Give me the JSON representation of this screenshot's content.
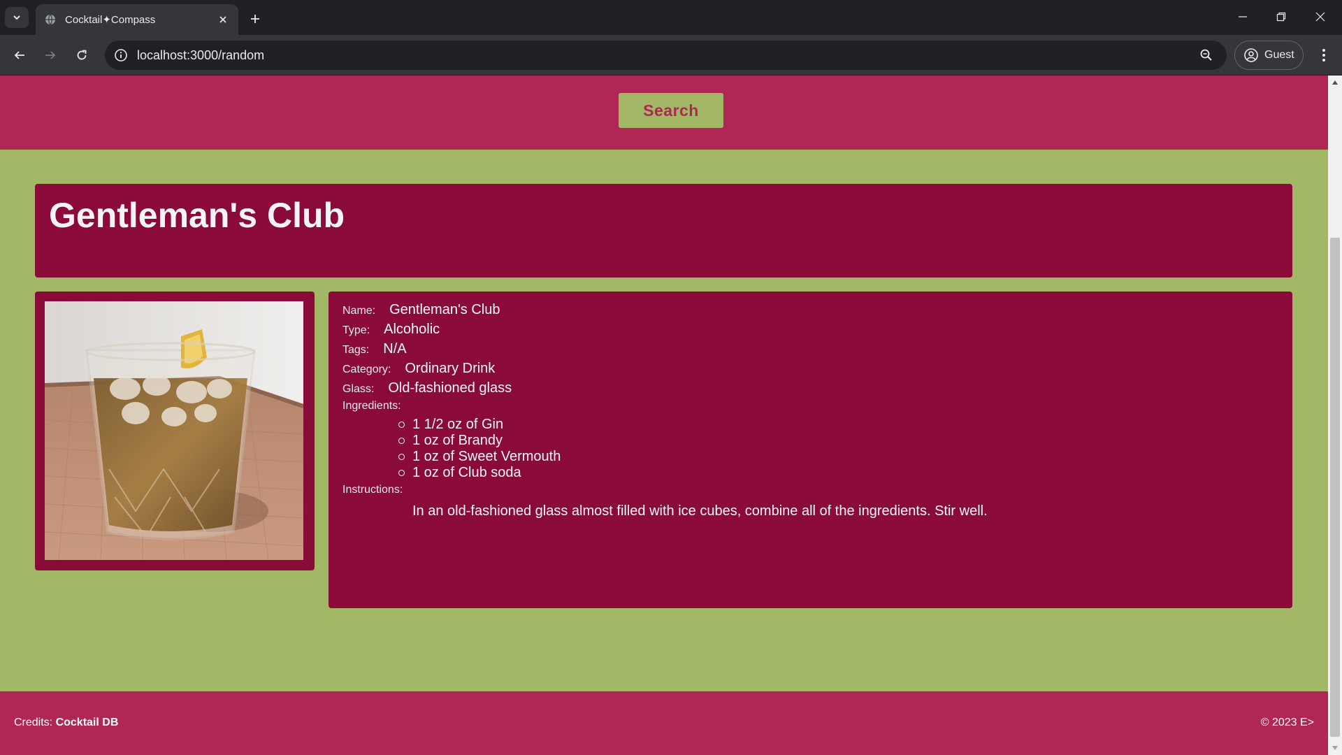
{
  "browser": {
    "tab_title": "Cocktail✦Compass",
    "url": "localhost:3000/random",
    "profile_label": "Guest"
  },
  "page": {
    "search_label": "Search",
    "drink_title": "Gentleman's Club",
    "details": {
      "name_label": "Name:",
      "name_value": "Gentleman's Club",
      "type_label": "Type:",
      "type_value": "Alcoholic",
      "tags_label": "Tags:",
      "tags_value": "N/A",
      "category_label": "Category:",
      "category_value": "Ordinary Drink",
      "glass_label": "Glass:",
      "glass_value": "Old-fashioned glass",
      "ingredients_label": "Ingredients:",
      "ingredients": [
        "1 1/2 oz of Gin",
        "1 oz of Brandy",
        "1 oz of Sweet Vermouth",
        "1 oz of Club soda"
      ],
      "instructions_label": "Instructions:",
      "instructions": "In an old-fashioned glass almost filled with ice cubes, combine all of the ingredients. Stir well."
    },
    "footer": {
      "credits_prefix": "Credits:",
      "credits_source": "Cocktail DB",
      "copyright": "© 2023 E>"
    }
  },
  "colors": {
    "accent_pink": "#b02756",
    "card_maroon": "#8a0b3a",
    "background_green": "#a3b866"
  }
}
